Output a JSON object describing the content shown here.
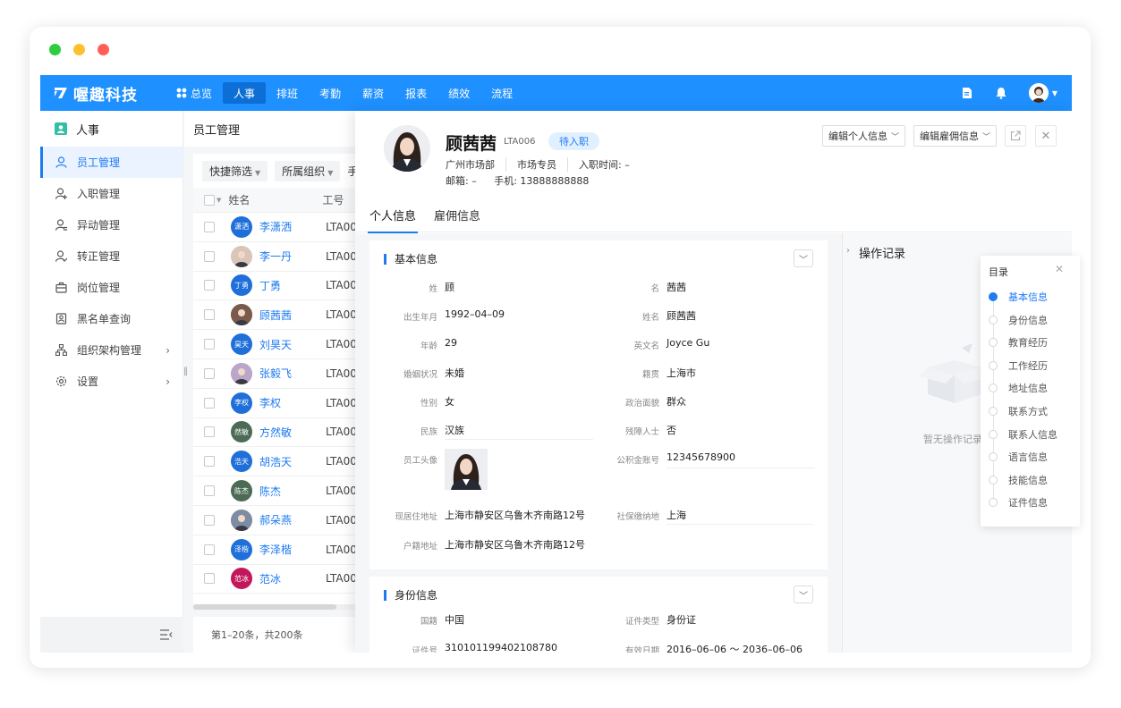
{
  "window": {
    "dot_colors": [
      "#2ecc40",
      "#ffc02e",
      "#ff5f57"
    ]
  },
  "topnav": {
    "brand": "喔趣科技",
    "items": [
      {
        "label": "总览",
        "active": false
      },
      {
        "label": "人事",
        "active": true
      },
      {
        "label": "排班",
        "active": false
      },
      {
        "label": "考勤",
        "active": false
      },
      {
        "label": "薪资",
        "active": false
      },
      {
        "label": "报表",
        "active": false
      },
      {
        "label": "绩效",
        "active": false
      },
      {
        "label": "流程",
        "active": false
      }
    ],
    "accent_color": "#1e90ff"
  },
  "sidebar": {
    "title": "人事",
    "items": [
      {
        "label": "员工管理",
        "icon": "user-icon"
      },
      {
        "label": "入职管理",
        "icon": "user-add-icon"
      },
      {
        "label": "异动管理",
        "icon": "user-switch-icon"
      },
      {
        "label": "转正管理",
        "icon": "user-check-icon"
      },
      {
        "label": "岗位管理",
        "icon": "briefcase-icon"
      },
      {
        "label": "黑名单查询",
        "icon": "id-card-icon"
      },
      {
        "label": "组织架构管理",
        "icon": "org-chart-icon"
      },
      {
        "label": "设置",
        "icon": "gear-icon"
      }
    ]
  },
  "employee_list": {
    "title": "员工管理",
    "filters": [
      "快捷筛选",
      "所属组织",
      "手"
    ],
    "columns": {
      "name": "姓名",
      "number": "工号"
    },
    "rows": [
      {
        "name": "李潇洒",
        "number": "LTA00",
        "avatar": "潇洒",
        "color": "#1e6fd9"
      },
      {
        "name": "李一丹",
        "number": "LTA00",
        "avatar": "",
        "color": "#d9c6b8"
      },
      {
        "name": "丁勇",
        "number": "LTA00",
        "avatar": "丁勇",
        "color": "#1e6fd9"
      },
      {
        "name": "顾茜茜",
        "number": "LTA00",
        "avatar": "",
        "color": "#7a5a4a"
      },
      {
        "name": "刘昊天",
        "number": "LTA00",
        "avatar": "昊天",
        "color": "#1e6fd9"
      },
      {
        "name": "张毅飞",
        "number": "LTA00",
        "avatar": "",
        "color": "#b9a6c9"
      },
      {
        "name": "李权",
        "number": "LTA00",
        "avatar": "李权",
        "color": "#1e6fd9"
      },
      {
        "name": "方然敏",
        "number": "LTA00",
        "avatar": "然敏",
        "color": "#4b6b55"
      },
      {
        "name": "胡浩天",
        "number": "LTA00",
        "avatar": "浩天",
        "color": "#1e6fd9"
      },
      {
        "name": "陈杰",
        "number": "LTA00",
        "avatar": "陈杰",
        "color": "#4b6b55"
      },
      {
        "name": "郝朵燕",
        "number": "LTA00",
        "avatar": "",
        "color": "#7e8ca3"
      },
      {
        "name": "李泽楷",
        "number": "LTA00",
        "avatar": "泽楷",
        "color": "#1e6fd9"
      },
      {
        "name": "范冰",
        "number": "LTA00",
        "avatar": "范冰",
        "color": "#c2185b"
      }
    ],
    "pagination": "第1–20条，共200条"
  },
  "detail": {
    "name": "顾茜茜",
    "code": "LTA006",
    "status": "待入职",
    "meta": [
      "广州市场部",
      "市场专员",
      "入职时间: –"
    ],
    "email": "邮箱: –",
    "phone": "手机: 13888888888",
    "edit_personal": "编辑个人信息",
    "edit_employment": "编辑雇佣信息",
    "tabs": [
      "个人信息",
      "雇佣信息"
    ],
    "basic": {
      "title": "基本信息",
      "fields": [
        {
          "label": "姓",
          "value": "顾"
        },
        {
          "label": "名",
          "value": "茜茜"
        },
        {
          "label": "出生年月",
          "value": "1992–04–09"
        },
        {
          "label": "姓名",
          "value": "顾茜茜"
        },
        {
          "label": "年龄",
          "value": "29"
        },
        {
          "label": "英文名",
          "value": "Joyce Gu"
        },
        {
          "label": "婚姻状况",
          "value": "未婚"
        },
        {
          "label": "籍贯",
          "value": "上海市"
        },
        {
          "label": "性别",
          "value": "女"
        },
        {
          "label": "政治面貌",
          "value": "群众"
        },
        {
          "label": "民族",
          "value": "汉族"
        },
        {
          "label": "残障人士",
          "value": "否"
        },
        {
          "label": "员工头像",
          "value": ""
        },
        {
          "label": "公积金账号",
          "value": "12345678900"
        },
        {
          "label": "现居住地址",
          "value": "上海市静安区乌鲁木齐南路12号"
        },
        {
          "label": "社保缴纳地",
          "value": "上海"
        },
        {
          "label": "户籍地址",
          "value": "上海市静安区乌鲁木齐南路12号"
        }
      ]
    },
    "identity": {
      "title": "身份信息",
      "fields": [
        {
          "label": "国籍",
          "value": "中国"
        },
        {
          "label": "证件类型",
          "value": "身份证"
        },
        {
          "label": "证件号",
          "value": "310101199402108780"
        },
        {
          "label": "有效日期",
          "value": "2016–06–06 ～ 2036–06–06"
        }
      ]
    },
    "oplog": {
      "title": "操作记录",
      "empty": "暂无操作记录"
    }
  },
  "toc": {
    "title": "目录",
    "items": [
      "基本信息",
      "身份信息",
      "教育经历",
      "工作经历",
      "地址信息",
      "联系方式",
      "联系人信息",
      "语言信息",
      "技能信息",
      "证件信息"
    ],
    "active_index": 0
  }
}
